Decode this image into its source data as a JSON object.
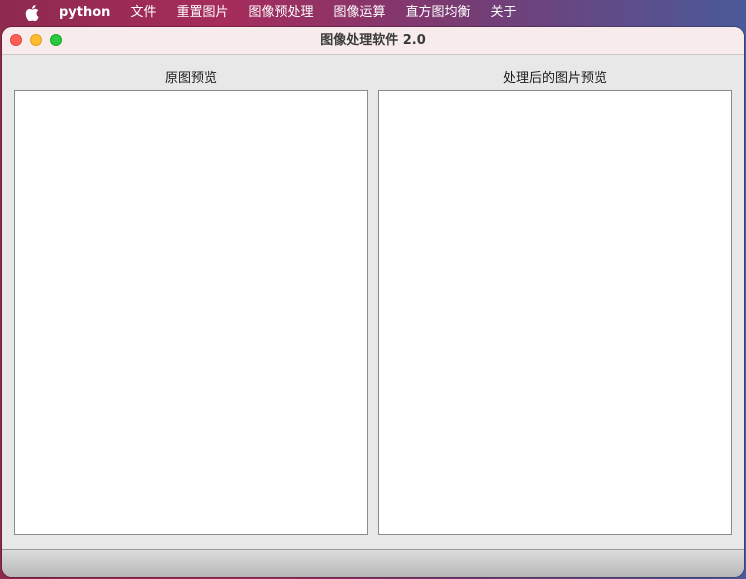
{
  "menubar": {
    "app_name": "python",
    "items": [
      "文件",
      "重置图片",
      "图像预处理",
      "图像运算",
      "直方图均衡",
      "关于"
    ]
  },
  "window": {
    "title": "图像处理软件 2.0"
  },
  "panels": {
    "original_label": "原图预览",
    "processed_label": "处理后的图片预览"
  }
}
